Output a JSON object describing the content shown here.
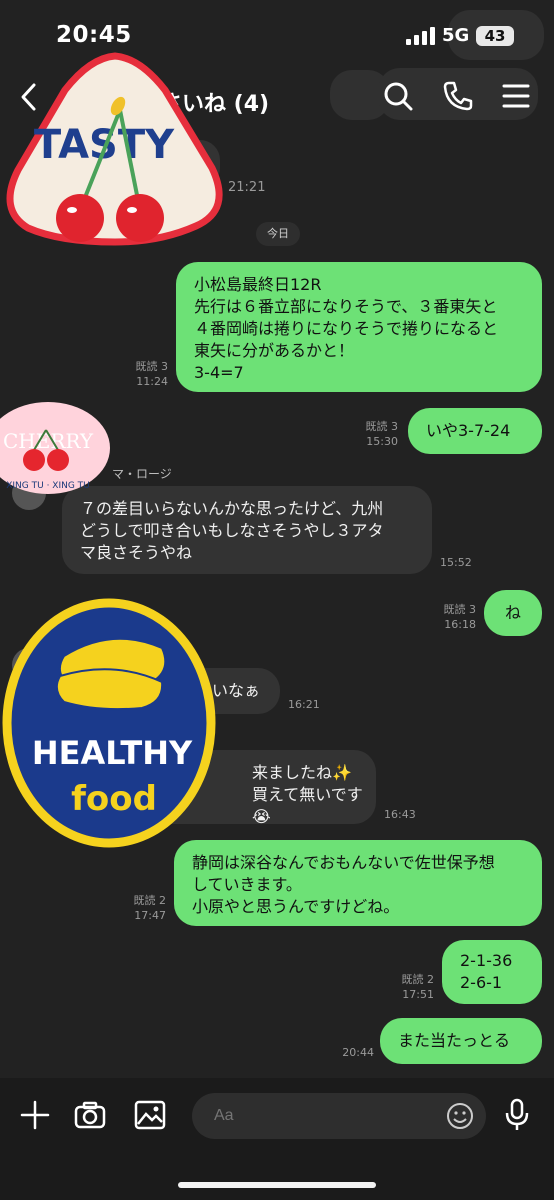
{
  "status": {
    "time": "20:45",
    "network": "5G",
    "battery": "43"
  },
  "header": {
    "title": "さいね (4)"
  },
  "messages": {
    "m0_time": "21:21",
    "date_label": "今日",
    "m1": {
      "text": "小松島最終日12R\n先行は６番立部になりそうで、３番東矢と\n４番岡崎は捲りになりそうで捲りになると\n東矢に分があるかと！\n3-4=7",
      "read": "既読 3",
      "time": "11:24"
    },
    "m2": {
      "text": "いや3-7-24",
      "read": "既読 3",
      "time": "15:30"
    },
    "m3": {
      "sender": "マ・ロージ",
      "text": "７の差目いらないんかな思ったけど、九州\nどうしで叩き合いもしなさそうやし３アタ\nマ良さそうやね",
      "time": "15:52"
    },
    "m4": {
      "text": "ね",
      "read": "既読 3",
      "time": "16:18"
    },
    "m5": {
      "text": "いなぁ",
      "time": "16:21"
    },
    "m6": {
      "text": "来ましたね✨\n買えて無いです😭",
      "time": "16:43"
    },
    "m7": {
      "text": "静岡は深谷なんでおもんないで佐世保予想\nしていきます。\n小原やと思うんですけどね。",
      "read": "既読 2",
      "time": "17:47"
    },
    "m8": {
      "text": "2-1-36\n2-6-1",
      "read": "既読 2",
      "time": "17:51"
    },
    "m9": {
      "text": "また当たっとる",
      "time": "20:44"
    }
  },
  "stickers": {
    "tasty": "TASTY",
    "cherry": "CHERRY",
    "cherry_ring": "XING TU · XING TU",
    "healthy": "HEALTHY",
    "food": "food"
  },
  "input": {
    "placeholder": "Aa"
  },
  "colors": {
    "background": "#222222",
    "outgoing": "#6de176",
    "incoming": "#333333"
  }
}
